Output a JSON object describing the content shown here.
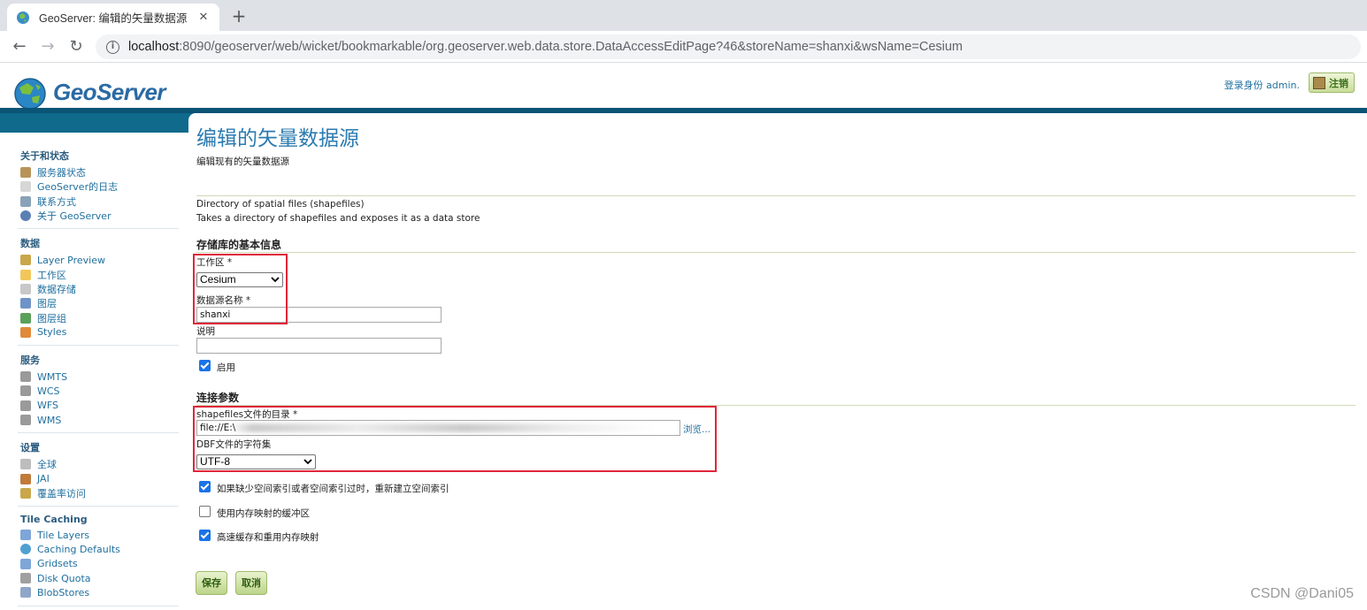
{
  "browser": {
    "tab_title": "GeoServer: 编辑的矢量数据源",
    "tab_close": "✕",
    "new_tab": "+",
    "url_host": "localhost",
    "url_rest": ":8090/geoserver/web/wicket/bookmarkable/org.geoserver.web.data.store.DataAccessEditPage?46&storeName=shanxi&wsName=Cesium",
    "back": "←",
    "forward": "→",
    "reload": "↻"
  },
  "header": {
    "logo_text": "GeoServer",
    "login_info": "登录身份 admin.",
    "logout_label": "注销"
  },
  "sidebar": {
    "sections": [
      {
        "title": "关于和状态",
        "items": [
          {
            "label": "服务器状态",
            "icon": "server-status-icon"
          },
          {
            "label": "GeoServer的日志",
            "icon": "log-icon"
          },
          {
            "label": "联系方式",
            "icon": "contact-icon"
          },
          {
            "label": "关于 GeoServer",
            "icon": "about-icon"
          }
        ]
      },
      {
        "title": "数据",
        "items": [
          {
            "label": "Layer Preview",
            "icon": "layer-preview-icon"
          },
          {
            "label": "工作区",
            "icon": "folder-icon"
          },
          {
            "label": "数据存储",
            "icon": "datastore-icon"
          },
          {
            "label": "图层",
            "icon": "layer-icon"
          },
          {
            "label": "图层组",
            "icon": "layergroup-icon"
          },
          {
            "label": "Styles",
            "icon": "styles-icon"
          }
        ]
      },
      {
        "title": "服务",
        "items": [
          {
            "label": "WMTS",
            "icon": "service-icon"
          },
          {
            "label": "WCS",
            "icon": "service-icon"
          },
          {
            "label": "WFS",
            "icon": "service-icon"
          },
          {
            "label": "WMS",
            "icon": "service-icon"
          }
        ]
      },
      {
        "title": "设置",
        "items": [
          {
            "label": "全球",
            "icon": "global-icon"
          },
          {
            "label": "JAI",
            "icon": "jai-icon"
          },
          {
            "label": "覆盖率访问",
            "icon": "coverage-icon"
          }
        ]
      },
      {
        "title": "Tile Caching",
        "items": [
          {
            "label": "Tile Layers",
            "icon": "tile-layers-icon"
          },
          {
            "label": "Caching Defaults",
            "icon": "caching-defaults-icon"
          },
          {
            "label": "Gridsets",
            "icon": "gridsets-icon"
          },
          {
            "label": "Disk Quota",
            "icon": "disk-quota-icon"
          },
          {
            "label": "BlobStores",
            "icon": "blobstores-icon"
          }
        ]
      }
    ]
  },
  "main": {
    "title": "编辑的矢量数据源",
    "description": "编辑现有的矢量数据源",
    "store_type": "Directory of spatial files (shapefiles)",
    "store_type_desc": "Takes a directory of shapefiles and exposes it as a data store",
    "basic_section": "存储库的基本信息",
    "workspace_label": "工作区 *",
    "workspace_value": "Cesium",
    "name_label": "数据源名称 *",
    "name_value": "shanxi",
    "desc_label": "说明",
    "desc_value": "",
    "enabled_label": "启用",
    "enabled": true,
    "conn_section": "连接参数",
    "dir_label": "shapefiles文件的目录 *",
    "dir_value_visible": "file://E:\\",
    "browse_label": "浏览...",
    "charset_label": "DBF文件的字符集",
    "charset_value": "UTF-8",
    "options": [
      {
        "label": "如果缺少空间索引或者空间索引过时，重新建立空间索引",
        "checked": true
      },
      {
        "label": "使用内存映射的缓冲区",
        "checked": false
      },
      {
        "label": "高速缓存和重用内存映射",
        "checked": true
      }
    ],
    "save_label": "保存",
    "cancel_label": "取消"
  },
  "watermark": "CSDN @Dani05"
}
